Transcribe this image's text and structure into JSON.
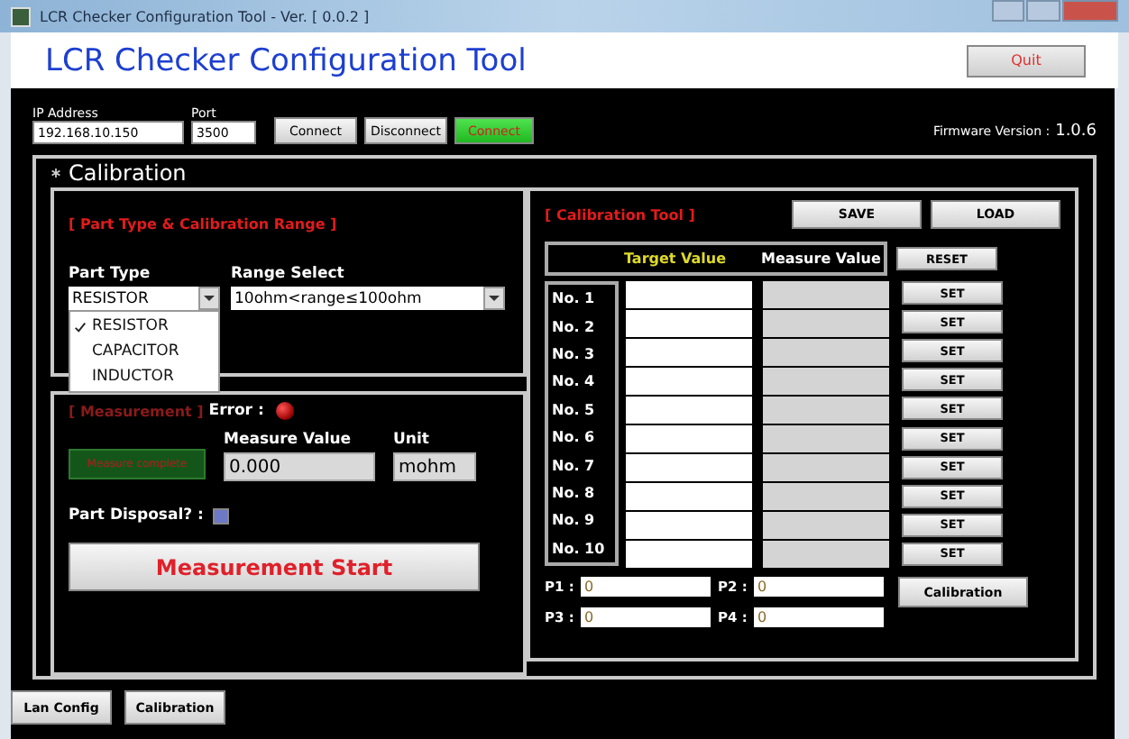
{
  "window": {
    "title": "LCR Checker Configuration Tool - Ver. [ 0.0.2 ]"
  },
  "header": {
    "title": "LCR Checker Configuration Tool",
    "quit_button": "Quit"
  },
  "connection": {
    "ip_label": "IP Address",
    "ip": "192.168.10.150",
    "port_label": "Port",
    "port": "3500",
    "buttons": [
      {
        "label": "Connect",
        "kind": "normal"
      },
      {
        "label": "Disconnect",
        "kind": "normal"
      },
      {
        "label": "Connect",
        "kind": "status"
      }
    ],
    "firmware_label": "Firmware Version :",
    "firmware": "1.0.6"
  },
  "calibration": {
    "title": "Calibration",
    "part_group": {
      "title": "[ Part Type & Calibration Range ]",
      "part_type_label": "Part Type",
      "part_type": "RESISTOR",
      "range_label": "Range Select",
      "range": "10ohm<range≤100ohm",
      "dropdown": [
        {
          "label": "RESISTOR",
          "selected": true
        },
        {
          "label": "CAPACITOR",
          "selected": false
        },
        {
          "label": "INDUCTOR",
          "selected": false
        }
      ]
    },
    "measure_group": {
      "title": "[ Measurement ]",
      "error_label": "Error :",
      "status_button": "Measure complete",
      "measure_label": "Measure Value",
      "measure_value": "0.000",
      "unit_label": "Unit",
      "unit": "mohm",
      "disposal_label": "Part Disposal? :",
      "disposal_checked": true,
      "start_button": "Measurement Start"
    },
    "tool_group": {
      "title": "[ Calibration Tool ]",
      "save_button": "SAVE",
      "load_button": "LOAD",
      "target_header": "Target Value",
      "measure_header": "Measure Value",
      "reset_button": "RESET",
      "rows": [
        {
          "label": "No. 1",
          "button": "SET"
        },
        {
          "label": "No. 2",
          "button": "SET"
        },
        {
          "label": "No. 3",
          "button": "SET"
        },
        {
          "label": "No. 4",
          "button": "SET"
        },
        {
          "label": "No. 5",
          "button": "SET"
        },
        {
          "label": "No. 6",
          "button": "SET"
        },
        {
          "label": "No. 7",
          "button": "SET"
        },
        {
          "label": "No. 8",
          "button": "SET"
        },
        {
          "label": "No. 9",
          "button": "SET"
        },
        {
          "label": "No. 10",
          "button": "SET"
        }
      ],
      "params": [
        {
          "label": "P1 :",
          "value": "0"
        },
        {
          "label": "P2 :",
          "value": "0"
        },
        {
          "label": "P3 :",
          "value": "0"
        },
        {
          "label": "P4 :",
          "value": "0"
        }
      ],
      "calibration_button": "Calibration"
    }
  },
  "bottom_tabs": [
    {
      "label": "Lan Config"
    },
    {
      "label": "Calibration"
    }
  ]
}
